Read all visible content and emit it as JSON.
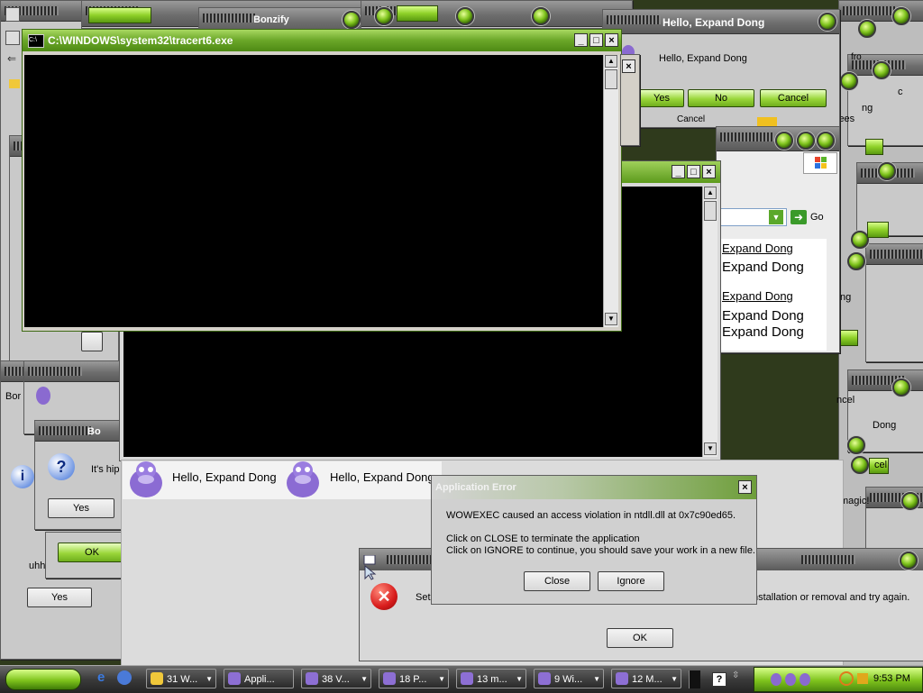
{
  "console": {
    "title": "C:\\WINDOWS\\system32\\tracert6.exe",
    "min": "_",
    "max": "□",
    "close": "×"
  },
  "top_dialog": {
    "title": "Hello, Expand Dong",
    "message": "Hello, Expand Dong",
    "yes": "Yes",
    "no": "No",
    "cancel": "Cancel",
    "behind_cancel": "Cancel"
  },
  "bonzify_title": "Bonzify",
  "second_console": {
    "min": "_",
    "max": "□",
    "close": "×"
  },
  "browser": {
    "go": "Go",
    "links": [
      "Expand Dong",
      "Expand Dong",
      "Expand Dong",
      "Expand Dong",
      "Expand Dong"
    ]
  },
  "bonzi_bar": {
    "speech1": "Hello, Expand Dong",
    "speech2": "Hello, Expand Dong"
  },
  "left_dialog": {
    "title": "Bo",
    "text": "It's hip",
    "yes": "Yes",
    "ok": "OK",
    "text2": "uhh",
    "yes2": "Yes",
    "label": "Bor"
  },
  "error_dialog": {
    "title": "Application Error",
    "line1": "WOWEXEC caused an access violation in ntdll.dll at 0x7c90ed65.",
    "line2": "Click on CLOSE to terminate the application",
    "line3": "Click on IGNORE to continue, you should save your work in a new file.",
    "close": "Close",
    "ignore": "Ignore"
  },
  "installer": {
    "text_left": "Set",
    "text_right": "nstallation or removal and try again.",
    "ok": "OK"
  },
  "right_fragments": {
    "f1": "lees",
    "f2": "ng",
    "f3": "ncel",
    "f4": "ng",
    "f5": "Dong",
    "f6": "cel",
    "f7": "magic!",
    "f8": "c",
    "f9": "fro"
  },
  "taskbar": {
    "items": [
      {
        "label": "31 W..."
      },
      {
        "label": "Appli..."
      },
      {
        "label": "38 V..."
      },
      {
        "label": "18 P..."
      },
      {
        "label": "13 m..."
      },
      {
        "label": "9 Wi..."
      },
      {
        "label": "12 M..."
      }
    ],
    "help": "?",
    "clock": "9:53 PM"
  },
  "colors": {
    "accent": "#7ec31c",
    "error": "#d81c1c",
    "console_bg": "#000000"
  }
}
